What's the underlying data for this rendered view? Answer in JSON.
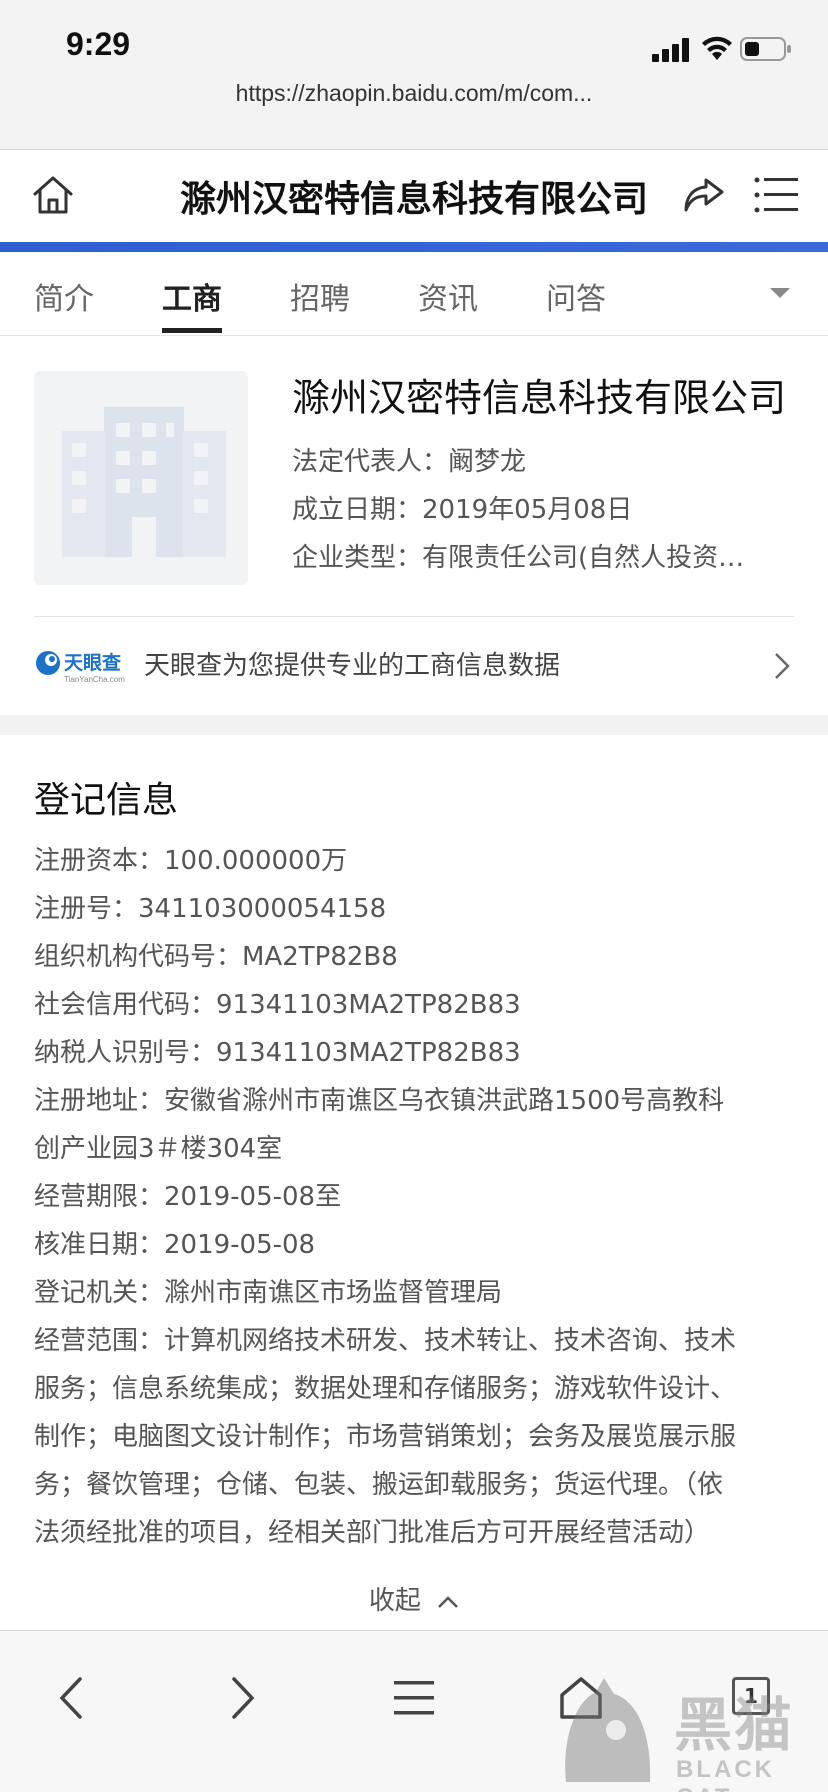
{
  "status_bar": {
    "time": "9:29",
    "url": "https://zhaopin.baidu.com/m/com..."
  },
  "title_bar": {
    "title": "滁州汉密特信息科技有限公司"
  },
  "tabs": [
    {
      "label": "简介",
      "active": false
    },
    {
      "label": "工商",
      "active": true
    },
    {
      "label": "招聘",
      "active": false
    },
    {
      "label": "资讯",
      "active": false
    },
    {
      "label": "问答",
      "active": false
    }
  ],
  "company": {
    "name": "滁州汉密特信息科技有限公司",
    "legal_rep": "法定代表人：阚梦龙",
    "founded": "成立日期：2019年05月08日",
    "type": "企业类型：有限责任公司(自然人投资…",
    "tianyancha_brand": "天眼查",
    "tianyancha_domain": "TianYanCha.com",
    "tianyancha_text": "天眼查为您提供专业的工商信息数据"
  },
  "registration": {
    "title": "登记信息",
    "lines": [
      "注册资本：100.000000万",
      "注册号：341103000054158",
      "组织机构代码号：MA2TP82B8",
      "社会信用代码：91341103MA2TP82B83",
      "纳税人识别号：91341103MA2TP82B83",
      "注册地址：安徽省滁州市南谯区乌衣镇洪武路1500号高教科",
      "创产业园3＃楼304室",
      "经营期限：2019-05-08至",
      "核准日期：2019-05-08",
      "登记机关：滁州市南谯区市场监督管理局",
      "经营范围：计算机网络技术研发、技术转让、技术咨询、技术",
      "服务；信息系统集成；数据处理和存储服务；游戏软件设计、",
      "制作；电脑图文设计制作；市场营销策划；会务及展览展示服",
      "务；餐饮管理；仓储、包装、搬运卸载服务；货运代理。（依",
      "法须经批准的项目，经相关部门批准后方可开展经营活动）"
    ],
    "collapse_label": "收起"
  },
  "bottom_bar": {
    "tab_count": "1"
  },
  "watermark": {
    "text": "黑猫",
    "sub": "BLACK CAT"
  },
  "colors": {
    "accent_blue": "#2c5fd0",
    "tianyancha_blue": "#1a73c8"
  }
}
